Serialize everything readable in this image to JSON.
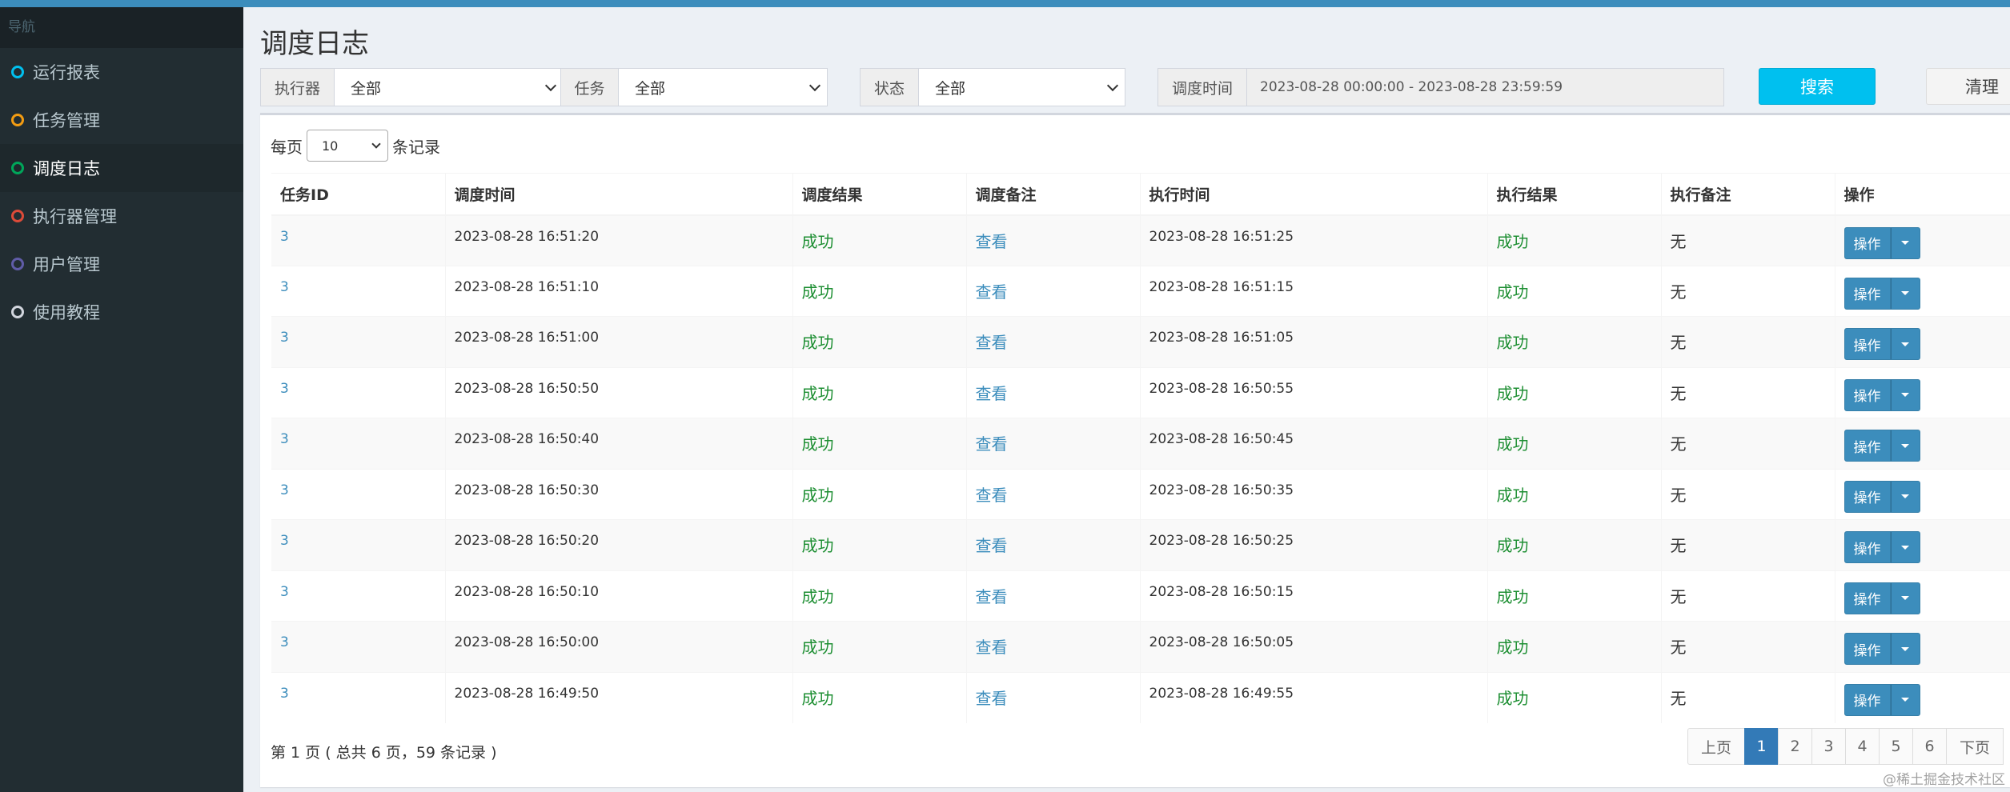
{
  "sidebar": {
    "header": "导航",
    "items": [
      {
        "label": "运行报表",
        "color": "#00c0ef"
      },
      {
        "label": "任务管理",
        "color": "#f39c12"
      },
      {
        "label": "调度日志",
        "color": "#00a65a"
      },
      {
        "label": "执行器管理",
        "color": "#dd4b39"
      },
      {
        "label": "用户管理",
        "color": "#605ca8"
      },
      {
        "label": "使用教程",
        "color": "#d2d6de"
      }
    ],
    "active_index": 2
  },
  "page": {
    "title": "调度日志"
  },
  "filters": {
    "executor": {
      "label": "执行器",
      "value": "全部"
    },
    "job": {
      "label": "任务",
      "value": "全部"
    },
    "status": {
      "label": "状态",
      "value": "全部"
    },
    "time": {
      "label": "调度时间",
      "value": "2023-08-28 00:00:00 - 2023-08-28 23:59:59"
    },
    "search_label": "搜索",
    "clear_label": "清理"
  },
  "length": {
    "prefix": "每页",
    "value": "10",
    "suffix": "条记录"
  },
  "table": {
    "headers": [
      "任务ID",
      "调度时间",
      "调度结果",
      "调度备注",
      "执行时间",
      "执行结果",
      "执行备注",
      "操作"
    ],
    "rows": [
      {
        "id": "3",
        "trigger_time": "2023-08-28 16:51:20",
        "trigger_result": "成功",
        "trigger_msg": "查看",
        "handle_time": "2023-08-28 16:51:25",
        "handle_result": "成功",
        "handle_msg": "无",
        "op": "操作"
      },
      {
        "id": "3",
        "trigger_time": "2023-08-28 16:51:10",
        "trigger_result": "成功",
        "trigger_msg": "查看",
        "handle_time": "2023-08-28 16:51:15",
        "handle_result": "成功",
        "handle_msg": "无",
        "op": "操作"
      },
      {
        "id": "3",
        "trigger_time": "2023-08-28 16:51:00",
        "trigger_result": "成功",
        "trigger_msg": "查看",
        "handle_time": "2023-08-28 16:51:05",
        "handle_result": "成功",
        "handle_msg": "无",
        "op": "操作"
      },
      {
        "id": "3",
        "trigger_time": "2023-08-28 16:50:50",
        "trigger_result": "成功",
        "trigger_msg": "查看",
        "handle_time": "2023-08-28 16:50:55",
        "handle_result": "成功",
        "handle_msg": "无",
        "op": "操作"
      },
      {
        "id": "3",
        "trigger_time": "2023-08-28 16:50:40",
        "trigger_result": "成功",
        "trigger_msg": "查看",
        "handle_time": "2023-08-28 16:50:45",
        "handle_result": "成功",
        "handle_msg": "无",
        "op": "操作"
      },
      {
        "id": "3",
        "trigger_time": "2023-08-28 16:50:30",
        "trigger_result": "成功",
        "trigger_msg": "查看",
        "handle_time": "2023-08-28 16:50:35",
        "handle_result": "成功",
        "handle_msg": "无",
        "op": "操作"
      },
      {
        "id": "3",
        "trigger_time": "2023-08-28 16:50:20",
        "trigger_result": "成功",
        "trigger_msg": "查看",
        "handle_time": "2023-08-28 16:50:25",
        "handle_result": "成功",
        "handle_msg": "无",
        "op": "操作"
      },
      {
        "id": "3",
        "trigger_time": "2023-08-28 16:50:10",
        "trigger_result": "成功",
        "trigger_msg": "查看",
        "handle_time": "2023-08-28 16:50:15",
        "handle_result": "成功",
        "handle_msg": "无",
        "op": "操作"
      },
      {
        "id": "3",
        "trigger_time": "2023-08-28 16:50:00",
        "trigger_result": "成功",
        "trigger_msg": "查看",
        "handle_time": "2023-08-28 16:50:05",
        "handle_result": "成功",
        "handle_msg": "无",
        "op": "操作"
      },
      {
        "id": "3",
        "trigger_time": "2023-08-28 16:49:50",
        "trigger_result": "成功",
        "trigger_msg": "查看",
        "handle_time": "2023-08-28 16:49:55",
        "handle_result": "成功",
        "handle_msg": "无",
        "op": "操作"
      }
    ]
  },
  "info": "第 1 页 ( 总共 6 页，59 条记录 )",
  "pagination": {
    "prev": "上页",
    "pages": [
      "1",
      "2",
      "3",
      "4",
      "5",
      "6"
    ],
    "active": "1",
    "next": "下页"
  },
  "watermark": "@稀土掘金技术社区"
}
